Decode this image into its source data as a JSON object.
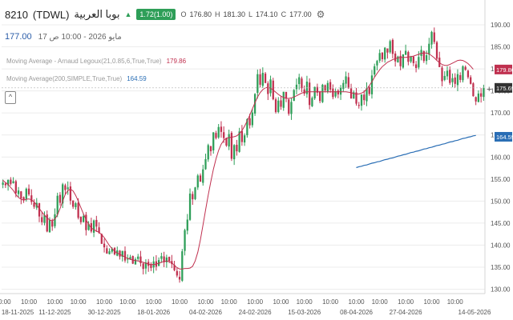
{
  "header": {
    "symbol": "8210",
    "ticker": "(TDWL)",
    "name": "بوبا العربية",
    "change": "1.72(1.00)",
    "o_label": "O",
    "o": "176.80",
    "h_label": "H",
    "h": "181.30",
    "l_label": "L",
    "l": "174.10",
    "c_label": "C",
    "c": "177.00",
    "icon_settings": "gear-icon",
    "icon_trend": "up-triangle-icon"
  },
  "last_price": "177.00",
  "date_line": "مايو 2026 - 10:00 ص 17",
  "indicators": [
    {
      "label": "Moving Average - Arnaud Legoux(21,0.85,6,True,True)",
      "value": "179.86",
      "color": "#c0304f"
    },
    {
      "label": "Moving Average(200,SIMPLE,True,True)",
      "value": "164.59",
      "color": "#2a6eb5"
    }
  ],
  "colors": {
    "up": "#2e9e58",
    "down": "#c0304f",
    "alma": "#c0304f",
    "sma": "#2a6eb5",
    "grid": "#ececec",
    "text": "#555555"
  },
  "chart_data": {
    "type": "candlestick",
    "ylim": [
      129,
      192
    ],
    "yticks": [
      130,
      135,
      140,
      145,
      150,
      155,
      160,
      165,
      170,
      175,
      180,
      185,
      190
    ],
    "price_labels": [
      {
        "value": 179.86,
        "text": "179.86",
        "color": "#c0304f"
      },
      {
        "value": 175.69,
        "text": "175.69",
        "color": "#333333"
      },
      {
        "value": 164.59,
        "text": "164.59",
        "color": "#2a6eb5"
      }
    ],
    "xlabels": [
      {
        "i": 0,
        "top": "10:00",
        "bottom": "18-11-2025"
      },
      {
        "i": 10,
        "top": "10:00",
        "bottom": ""
      },
      {
        "i": 20,
        "top": "10:00",
        "bottom": "11-12-2025"
      },
      {
        "i": 29,
        "top": "10:00",
        "bottom": ""
      },
      {
        "i": 39,
        "top": "10:00",
        "bottom": "30-12-2025"
      },
      {
        "i": 48,
        "top": "10:00",
        "bottom": ""
      },
      {
        "i": 58,
        "top": "10:00",
        "bottom": "18-01-2026"
      },
      {
        "i": 68,
        "top": "10:00",
        "bottom": ""
      },
      {
        "i": 78,
        "top": "10:00",
        "bottom": "04-02-2026"
      },
      {
        "i": 87,
        "top": "10:00",
        "bottom": ""
      },
      {
        "i": 97,
        "top": "10:00",
        "bottom": "24-02-2026"
      },
      {
        "i": 107,
        "top": "10:00",
        "bottom": ""
      },
      {
        "i": 116,
        "top": "10:00",
        "bottom": "15-03-2026"
      },
      {
        "i": 126,
        "top": "10:00",
        "bottom": ""
      },
      {
        "i": 136,
        "top": "10:00",
        "bottom": "08-04-2026"
      },
      {
        "i": 145,
        "top": "10:00",
        "bottom": ""
      },
      {
        "i": 155,
        "top": "10:00",
        "bottom": "27-04-2026"
      },
      {
        "i": 165,
        "top": "10:00",
        "bottom": ""
      },
      {
        "i": 174,
        "top": "10:00",
        "bottom": ""
      },
      {
        "i": 183,
        "top": "",
        "bottom": "14-05-2026"
      }
    ],
    "close": [
      154.2,
      153.6,
      154.8,
      153.9,
      154.5,
      151.8,
      152.4,
      150.6,
      150.2,
      152.8,
      151.5,
      149.8,
      148.7,
      149.6,
      146.5,
      145.2,
      146.8,
      143.1,
      145.7,
      144.2,
      147.0,
      151.2,
      149.6,
      153.8,
      152.5,
      153.1,
      150.1,
      148.7,
      149.5,
      146.2,
      145.2,
      146.6,
      143.4,
      144.8,
      143.1,
      145.6,
      144.2,
      142.8,
      140.3,
      139.5,
      138.1,
      138.6,
      139.2,
      137.9,
      138.8,
      137.4,
      138.7,
      136.5,
      136.9,
      137.3,
      135.8,
      136.8,
      137.4,
      135.9,
      134.6,
      136.1,
      135.3,
      134.8,
      136.3,
      135.1,
      136.6,
      137.5,
      136.1,
      137.2,
      136.4,
      135.7,
      134.3,
      133.1,
      132.2,
      138.6,
      143.4,
      145.8,
      151.7,
      150.4,
      153.1,
      155.8,
      154.4,
      157.2,
      159.5,
      162.7,
      161.3,
      165.6,
      164.3,
      166.8,
      165.7,
      164.3,
      162.6,
      165.2,
      159.6,
      162.7,
      161.3,
      165.8,
      163.4,
      164.9,
      168.6,
      167.2,
      170.1,
      174.3,
      178.8,
      176.4,
      179.1,
      176.8,
      174.3,
      177.6,
      173.1,
      170.2,
      172.8,
      171.4,
      174.8,
      173.3,
      169.8,
      172.5,
      175.2,
      176.4,
      178.1,
      175.6,
      174.4,
      177.1,
      171.8,
      173.4,
      175.9,
      174.6,
      172.7,
      176.4,
      175.1,
      176.8,
      175.3,
      173.6,
      174.9,
      174.2,
      175.7,
      176.8,
      178.3,
      175.6,
      173.3,
      174.7,
      172.1,
      171.6,
      174.2,
      172.9,
      175.6,
      174.3,
      178.5,
      180.6,
      181.8,
      183.6,
      182.2,
      184.8,
      183.7,
      186.3,
      183.4,
      181.7,
      182.8,
      180.6,
      183.3,
      184.1,
      181.6,
      182.8,
      181.3,
      180.2,
      182.7,
      184.3,
      181.8,
      183.1,
      185.7,
      188.4,
      186.1,
      182.3,
      180.4,
      177.2,
      178.4,
      179.6,
      176.8,
      177.9,
      176.6,
      178.8,
      177.5,
      180.6,
      179.8,
      178.1,
      176.6,
      173.8,
      172.6,
      174.4,
      173.7,
      175.7
    ],
    "alma": [
      154.7,
      154.2,
      153.8,
      153.1,
      152.4,
      151.5,
      150.8,
      150.4,
      150.2,
      150.4,
      150.5,
      150.3,
      149.8,
      149.1,
      148.3,
      147.5,
      146.8,
      146.2,
      145.7,
      145.5,
      145.9,
      146.9,
      148.3,
      150.0,
      151.5,
      152.4,
      152.7,
      152.3,
      151.3,
      150.0,
      148.5,
      147.1,
      145.8,
      144.7,
      143.9,
      143.5,
      143.2,
      142.9,
      142.4,
      141.7,
      140.8,
      139.9,
      139.2,
      138.6,
      138.2,
      137.9,
      137.6,
      137.3,
      137.0,
      136.8,
      136.6,
      136.5,
      136.4,
      136.3,
      136.1,
      135.9,
      135.7,
      135.6,
      135.6,
      135.7,
      135.9,
      136.1,
      136.3,
      136.4,
      136.3,
      136.0,
      135.4,
      134.9,
      134.6,
      134.6,
      134.7,
      134.7,
      134.8,
      135.2,
      136.4,
      138.4,
      141.2,
      144.5,
      148.0,
      151.3,
      154.4,
      157.2,
      159.6,
      161.5,
      162.9,
      163.8,
      164.3,
      164.4,
      164.5,
      164.6,
      164.8,
      165.3,
      166.0,
      167.0,
      168.2,
      169.5,
      170.9,
      172.3,
      173.6,
      174.6,
      175.3,
      175.7,
      175.8,
      175.6,
      175.2,
      174.7,
      174.2,
      173.8,
      173.5,
      173.3,
      173.3,
      173.4,
      173.6,
      173.9,
      174.2,
      174.5,
      174.7,
      174.8,
      174.8,
      174.8,
      174.8,
      174.8,
      174.8,
      174.8,
      174.8,
      174.8,
      174.8,
      174.8,
      174.8,
      174.8,
      174.8,
      174.8,
      174.8,
      174.7,
      174.6,
      174.4,
      174.3,
      174.3,
      174.5,
      174.8,
      175.4,
      176.2,
      177.1,
      178.1,
      179.0,
      179.8,
      180.5,
      181.0,
      181.5,
      181.8,
      182.1,
      182.3,
      182.5,
      182.6,
      182.6,
      182.6,
      182.7,
      182.8,
      182.9,
      183.1,
      183.3,
      183.5,
      183.6,
      183.6,
      183.4,
      183.0,
      182.5,
      181.9,
      181.4,
      181.0,
      180.8,
      180.8,
      181.0,
      181.3,
      181.6,
      181.9,
      182.0,
      181.9,
      181.6,
      181.2,
      180.6,
      179.9
    ],
    "sma_start_index": 136,
    "sma": [
      157.6,
      157.8,
      157.9,
      158.1,
      158.2,
      158.4,
      158.6,
      158.7,
      158.9,
      159.0,
      159.2,
      159.4,
      159.5,
      159.7,
      159.8,
      160.0,
      160.2,
      160.3,
      160.5,
      160.6,
      160.8,
      161.0,
      161.1,
      161.3,
      161.4,
      161.6,
      161.8,
      161.9,
      162.1,
      162.2,
      162.4,
      162.6,
      162.7,
      162.9,
      163.0,
      163.2,
      163.4,
      163.5,
      163.7,
      163.8,
      164.0,
      164.2,
      164.3,
      164.5,
      164.6,
      164.8,
      164.9
    ]
  }
}
